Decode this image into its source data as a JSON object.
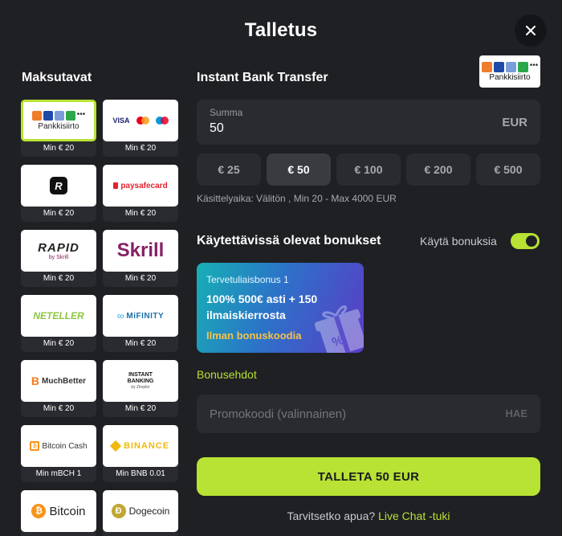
{
  "header": {
    "title": "Talletus",
    "close_icon": "close-icon"
  },
  "methods": {
    "title": "Maksutavat",
    "items": [
      {
        "id": "pankkisiirto",
        "logo_text": "Pankkisiirto",
        "min": "Min € 20",
        "selected": true
      },
      {
        "id": "cards",
        "logo_text": "VISA",
        "min": "Min € 20"
      },
      {
        "id": "revolut",
        "logo_text": "R",
        "min": "Min € 20"
      },
      {
        "id": "paysafecard",
        "logo_text": "paysafecard",
        "min": "Min € 20"
      },
      {
        "id": "rapid",
        "logo_text": "RAPID",
        "logo_sub": "by Skrill",
        "min": "Min € 20"
      },
      {
        "id": "skrill",
        "logo_text": "Skrill",
        "min": "Min € 20"
      },
      {
        "id": "neteller",
        "logo_text": "NETELLER",
        "min": "Min € 20"
      },
      {
        "id": "mifinity",
        "logo_text": "MiFINITY",
        "min": "Min € 20"
      },
      {
        "id": "muchbetter",
        "logo_text": "MuchBetter",
        "min": "Min € 20"
      },
      {
        "id": "instant-banking",
        "logo_text": "INSTANT BANKING",
        "logo_sub": "by Zimpler",
        "min": "Min € 20"
      },
      {
        "id": "bitcoin-cash",
        "logo_text": "Bitcoin Cash",
        "min": "Min mBCH 1"
      },
      {
        "id": "binance",
        "logo_text": "BINANCE",
        "min": "Min BNB 0.01"
      },
      {
        "id": "bitcoin",
        "logo_text": "Bitcoin",
        "min": ""
      },
      {
        "id": "dogecoin",
        "logo_text": "Dogecoin",
        "min": ""
      }
    ]
  },
  "provider": {
    "title": "Instant Bank Transfer",
    "logo_label": "Pankkisiirto"
  },
  "amount": {
    "label": "Summa",
    "value": "50",
    "currency": "EUR"
  },
  "quick_amounts": [
    {
      "label": "€ 25",
      "active": false
    },
    {
      "label": "€ 50",
      "active": true
    },
    {
      "label": "€ 100",
      "active": false
    },
    {
      "label": "€ 200",
      "active": false
    },
    {
      "label": "€ 500",
      "active": false
    }
  ],
  "processing_text": "Käsittelyaika: Välitön , Min 20 - Max 4000 EUR",
  "bonuses": {
    "title": "Käytettävissä olevat bonukset",
    "toggle_label": "Käytä bonuksia",
    "toggle_on": true,
    "card": {
      "subtitle": "Tervetuliaisbonus 1",
      "headline": "100% 500€ asti + 150 ilmaiskierrosta",
      "code_note": "Ilman bonuskoodia"
    },
    "terms_link": "Bonusehdot"
  },
  "promo": {
    "placeholder": "Promokoodi (valinnainen)",
    "value": "",
    "apply_label": "HAE"
  },
  "deposit_button": "TALLETA 50 EUR",
  "help": {
    "question": "Tarvitsetko apua?",
    "link": "Live Chat -tuki"
  },
  "colors": {
    "accent": "#b8e234",
    "background": "#1f2024",
    "panel": "#2a2b30"
  }
}
